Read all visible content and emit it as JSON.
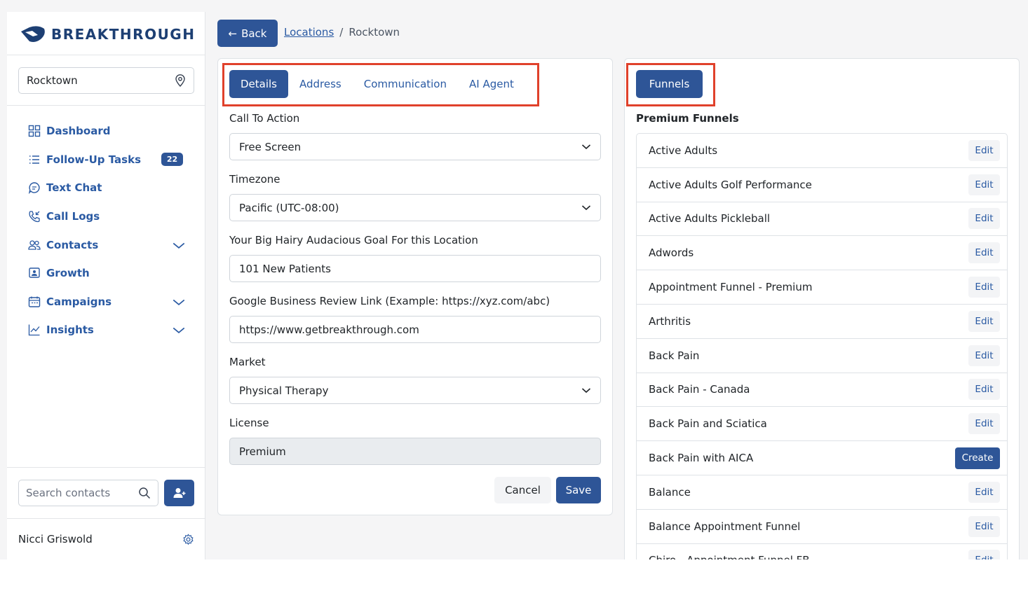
{
  "brand": {
    "name": "BREAKTHROUGH"
  },
  "sidebar": {
    "location": "Rocktown",
    "nav": [
      {
        "label": "Dashboard",
        "icon": "dashboard-icon"
      },
      {
        "label": "Follow-Up Tasks",
        "icon": "list-icon",
        "badge": "22"
      },
      {
        "label": "Text Chat",
        "icon": "chat-icon"
      },
      {
        "label": "Call Logs",
        "icon": "phone-icon"
      },
      {
        "label": "Contacts",
        "icon": "users-icon",
        "expandable": true
      },
      {
        "label": "Growth",
        "icon": "presentation-icon"
      },
      {
        "label": "Campaigns",
        "icon": "calendar-icon",
        "expandable": true
      },
      {
        "label": "Insights",
        "icon": "chart-icon",
        "expandable": true
      }
    ],
    "search_placeholder": "Search contacts",
    "user_name": "Nicci Griswold"
  },
  "header": {
    "back_label": "Back",
    "breadcrumb_link": "Locations",
    "breadcrumb_separator": "/",
    "breadcrumb_current": "Rocktown"
  },
  "details": {
    "tabs": [
      "Details",
      "Address",
      "Communication",
      "AI Agent"
    ],
    "active_tab": "Details",
    "fields": {
      "cta_label": "Call To Action",
      "cta_value": "Free Screen",
      "timezone_label": "Timezone",
      "timezone_value": "Pacific (UTC-08:00)",
      "goal_label": "Your Big Hairy Audacious Goal For this Location",
      "goal_value": "101 New Patients",
      "review_label": "Google Business Review Link (Example: https://xyz.com/abc)",
      "review_value": "https://www.getbreakthrough.com",
      "market_label": "Market",
      "market_value": "Physical Therapy",
      "license_label": "License",
      "license_value": "Premium"
    },
    "cancel_label": "Cancel",
    "save_label": "Save"
  },
  "funnels": {
    "tab_label": "Funnels",
    "section_title": "Premium Funnels",
    "items": [
      {
        "name": "Active Adults",
        "action": "Edit"
      },
      {
        "name": "Active Adults Golf Performance",
        "action": "Edit"
      },
      {
        "name": "Active Adults Pickleball",
        "action": "Edit"
      },
      {
        "name": "Adwords",
        "action": "Edit"
      },
      {
        "name": "Appointment Funnel - Premium",
        "action": "Edit"
      },
      {
        "name": "Arthritis",
        "action": "Edit"
      },
      {
        "name": "Back Pain",
        "action": "Edit"
      },
      {
        "name": "Back Pain - Canada",
        "action": "Edit"
      },
      {
        "name": "Back Pain and Sciatica",
        "action": "Edit"
      },
      {
        "name": "Back Pain with AICA",
        "action": "Create"
      },
      {
        "name": "Balance",
        "action": "Edit"
      },
      {
        "name": "Balance Appointment Funnel",
        "action": "Edit"
      },
      {
        "name": "Chiro - Appointment Funnel FB",
        "action": "Edit"
      }
    ]
  },
  "colors": {
    "primary": "#2e5597",
    "link": "#2a5aa3",
    "brand": "#1d3f73",
    "highlight": "#e0412b"
  }
}
